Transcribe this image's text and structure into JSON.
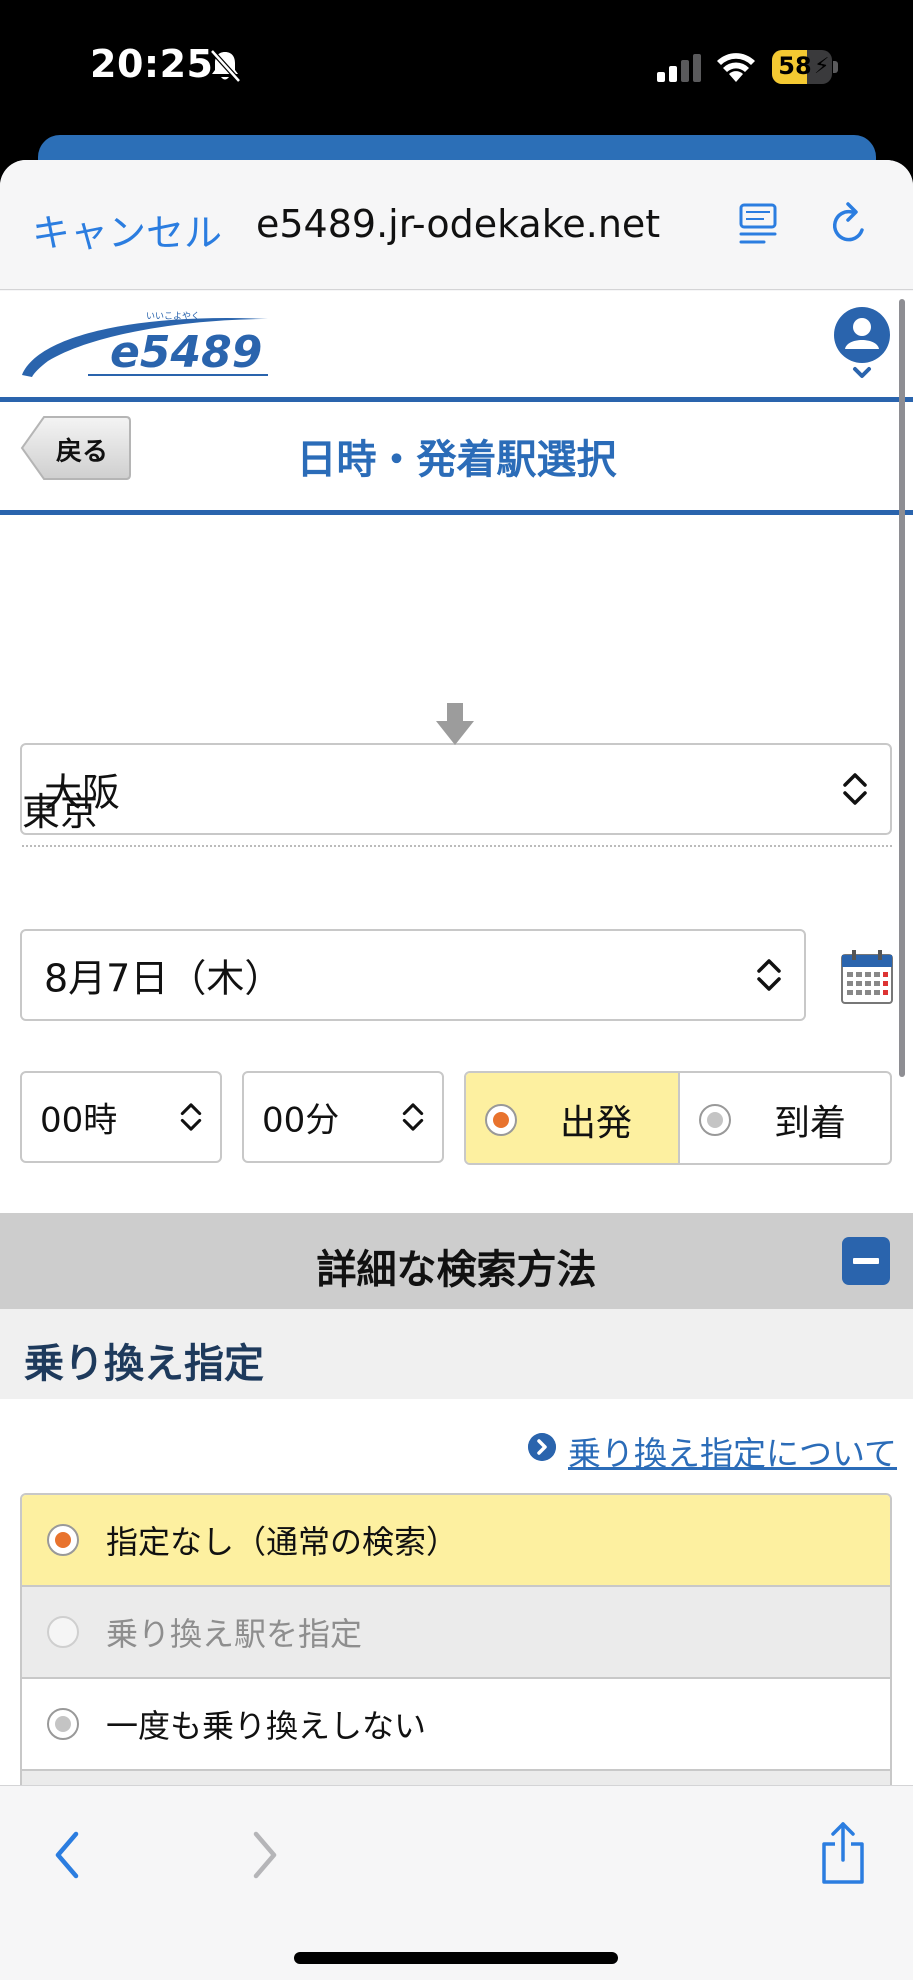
{
  "status_bar": {
    "time": "20:25",
    "battery_level": "58",
    "battery_fraction": 0.58,
    "icons": [
      "bell-slash-icon",
      "cellular-signal-icon",
      "wifi-icon",
      "battery-charging-icon"
    ]
  },
  "browser": {
    "cancel_label": "キャンセル",
    "url": "e5489.jr-odekake.net",
    "icons": [
      "reader-mode-icon",
      "reload-icon",
      "back-arrow-icon",
      "forward-arrow-icon",
      "share-icon"
    ]
  },
  "site": {
    "logo_text": "e5489",
    "logo_ruby": "いいこよやく",
    "logo_color": "#2a64ad"
  },
  "title_bar": {
    "back_label": "戻る",
    "title": "日時・発着駅選択"
  },
  "route": {
    "origin": "大阪",
    "destination": "東京"
  },
  "datetime": {
    "date": "8月7日（木）",
    "hour": "00時",
    "minute": "00分",
    "depart_label": "出発",
    "arrive_label": "到着",
    "selected": "出発"
  },
  "advanced": {
    "section_title": "詳細な検索方法",
    "subheading": "乗り換え指定",
    "help_link": "乗り換え指定について",
    "options": [
      {
        "label": "指定なし（通常の検索）",
        "state": "selected"
      },
      {
        "label": "乗り換え駅を指定",
        "state": "disabled"
      },
      {
        "label": "一度も乗り換えしない",
        "state": "normal"
      }
    ]
  },
  "colors": {
    "accent_blue": "#2a64ad",
    "link_blue": "#2b7de0",
    "selected_yellow": "#fdf0a0",
    "radio_orange": "#e8732e"
  }
}
